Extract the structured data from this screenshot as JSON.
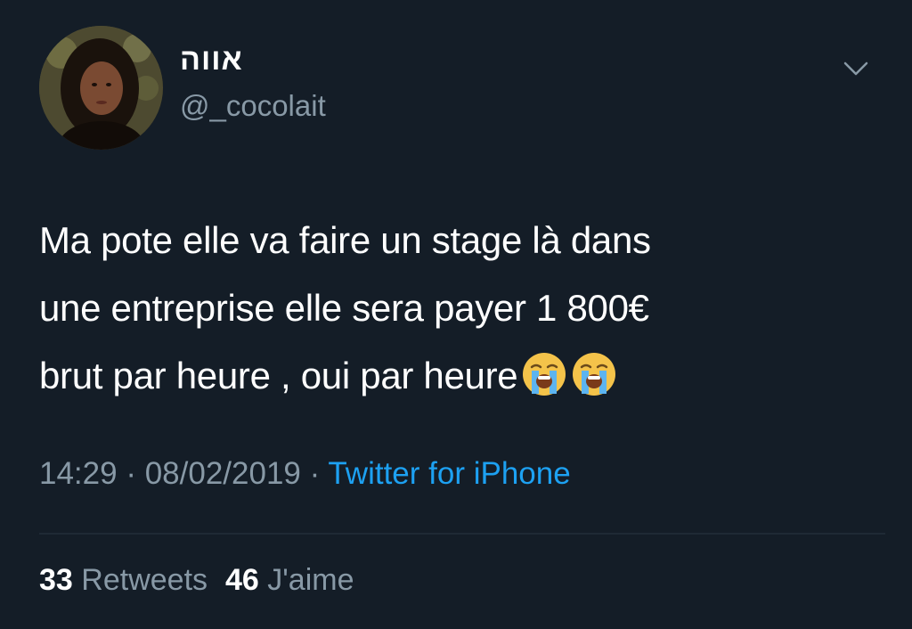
{
  "user": {
    "display_name": "אווה",
    "handle": "@_cocolait"
  },
  "tweet": {
    "line1": "Ma pote elle va faire un stage là dans",
    "line2": "une entreprise elle sera payer 1 800€",
    "line3": "brut par heure , oui par heure",
    "emojis": [
      "loudly-crying-face-emoji",
      "loudly-crying-face-emoji"
    ]
  },
  "meta": {
    "time": "14:29",
    "sep1": " · ",
    "date": "08/02/2019",
    "sep2": " · ",
    "source": "Twitter for iPhone"
  },
  "stats": {
    "retweets_count": "33",
    "retweets_label": "Retweets",
    "likes_count": "46",
    "likes_label": "J'aime"
  },
  "colors": {
    "background": "#141d27",
    "text": "#ffffff",
    "secondary": "#8899a6",
    "link": "#1da1f2"
  },
  "icons": {
    "menu": "chevron-down-icon"
  }
}
